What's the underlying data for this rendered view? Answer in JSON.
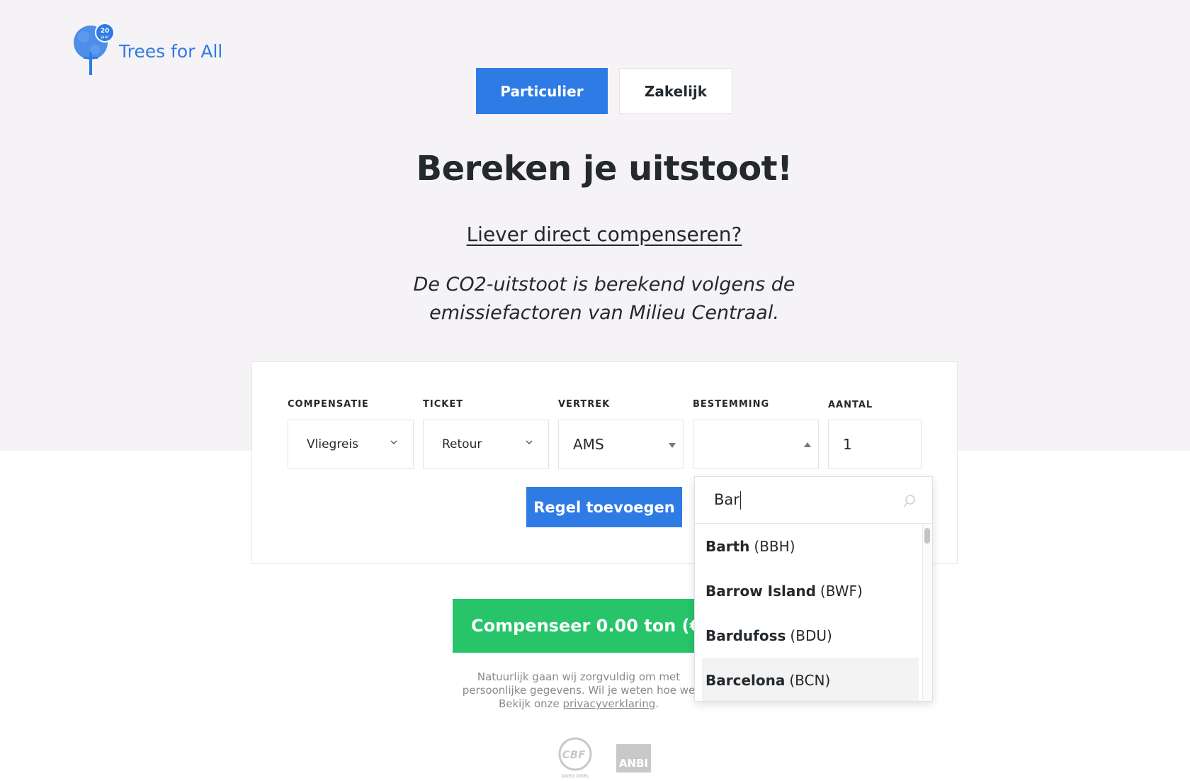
{
  "brand": {
    "name": "Trees for All",
    "badge": "20 jaar",
    "color": "#2f7be5"
  },
  "toggle": {
    "particulier": "Particulier",
    "zakelijk": "Zakelijk"
  },
  "heading": "Bereken je uitstoot!",
  "direct_link": "Liever direct compenseren?",
  "subtitle": "De CO2-uitstoot is berekend volgens de emissiefactoren van Milieu Centraal.",
  "form": {
    "compensatie": {
      "label": "COMPENSATIE",
      "value": "Vliegreis"
    },
    "ticket": {
      "label": "TICKET",
      "value": "Retour"
    },
    "vertrek": {
      "label": "VERTREK",
      "value": "AMS"
    },
    "bestemming": {
      "label": "BESTEMMING",
      "value": ""
    },
    "aantal": {
      "label": "AANTAL",
      "value": "1"
    },
    "add_button": "Regel toevoegen"
  },
  "dropdown": {
    "query": "Bar",
    "items": [
      {
        "name": "Barth",
        "code": "(BBH)"
      },
      {
        "name": "Barrow Island",
        "code": "(BWF)"
      },
      {
        "name": "Bardufoss",
        "code": "(BDU)"
      },
      {
        "name": "Barcelona",
        "code": "(BCN)"
      }
    ]
  },
  "compensate_button": "Compenseer 0.00 ton (€0.00)",
  "privacy": {
    "line1": "Natuurlijk gaan wij zorgvuldig om met",
    "line2": "persoonlijke gegevens. Wil je weten hoe we",
    "line3_prefix": "Bekijk onze",
    "link": "privacyverklaring",
    "line3_suffix": "."
  },
  "badges": {
    "cbf": "CBF",
    "cbf_sub": "GOED DOEL",
    "anbi": "ANBI"
  },
  "colors": {
    "primary": "#2f7be5",
    "green": "#27c46a",
    "text": "#24292e"
  }
}
